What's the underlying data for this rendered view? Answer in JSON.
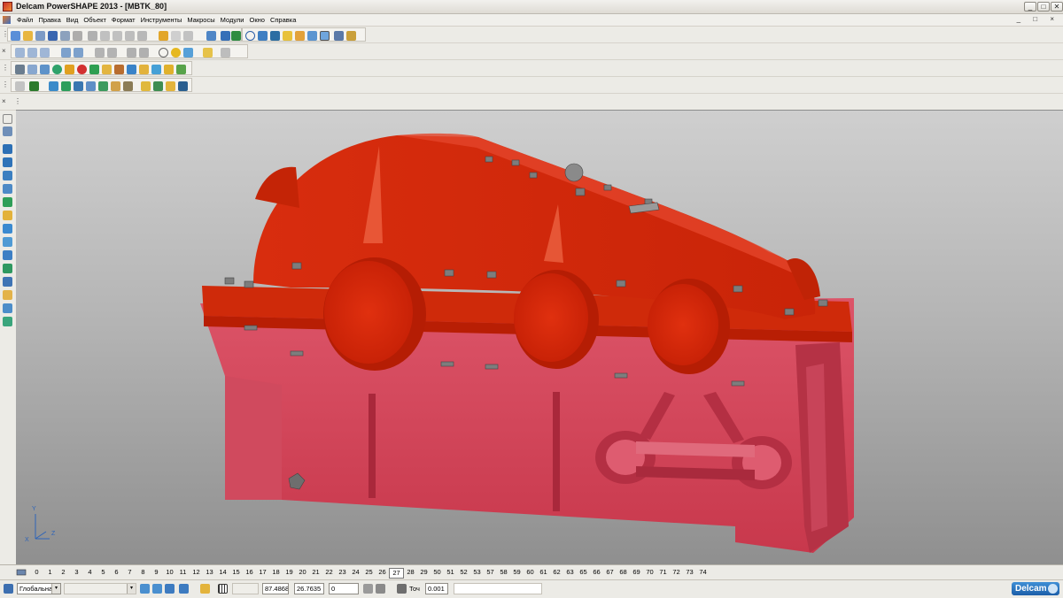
{
  "window": {
    "title": "Delcam PowerSHAPE 2013 - [MBTK_80]",
    "controls": [
      "_",
      "□",
      "✕"
    ]
  },
  "menubar": {
    "items": [
      "Файл",
      "Правка",
      "Вид",
      "Объект",
      "Формат",
      "Инструменты",
      "Макросы",
      "Модули",
      "Окно",
      "Справка"
    ],
    "doc_controls": "_ □ ×"
  },
  "toolbars": {
    "close_glyph": "×",
    "grip_glyph": "⋮"
  },
  "levels": {
    "items": [
      "0",
      "1",
      "2",
      "3",
      "4",
      "5",
      "6",
      "7",
      "8",
      "9",
      "10",
      "11",
      "12",
      "13",
      "14",
      "15",
      "16",
      "17",
      "18",
      "19",
      "20",
      "21",
      "22",
      "23",
      "24",
      "25",
      "26",
      "27",
      "28",
      "29",
      "50",
      "51",
      "52",
      "53",
      "57",
      "58",
      "59",
      "60",
      "61",
      "62",
      "63",
      "65",
      "66",
      "67",
      "68",
      "69",
      "70",
      "71",
      "72",
      "73",
      "74"
    ],
    "active": "27"
  },
  "status": {
    "workplane": "Глобальна",
    "workplane_arrow": "▾",
    "second_select_arrow": "▾",
    "x_value": "87.4868",
    "y_value": "26.7635",
    "z_value": "0",
    "tolerance_label": "Точ",
    "tolerance_value": "0.001"
  },
  "brand": {
    "label": "Delcam"
  },
  "triad": {
    "labels": [
      "Y",
      "X",
      "Z"
    ]
  },
  "colors": {
    "cover": "#d42a0c",
    "base": "#d4485b",
    "accent": "#2e64b8"
  }
}
